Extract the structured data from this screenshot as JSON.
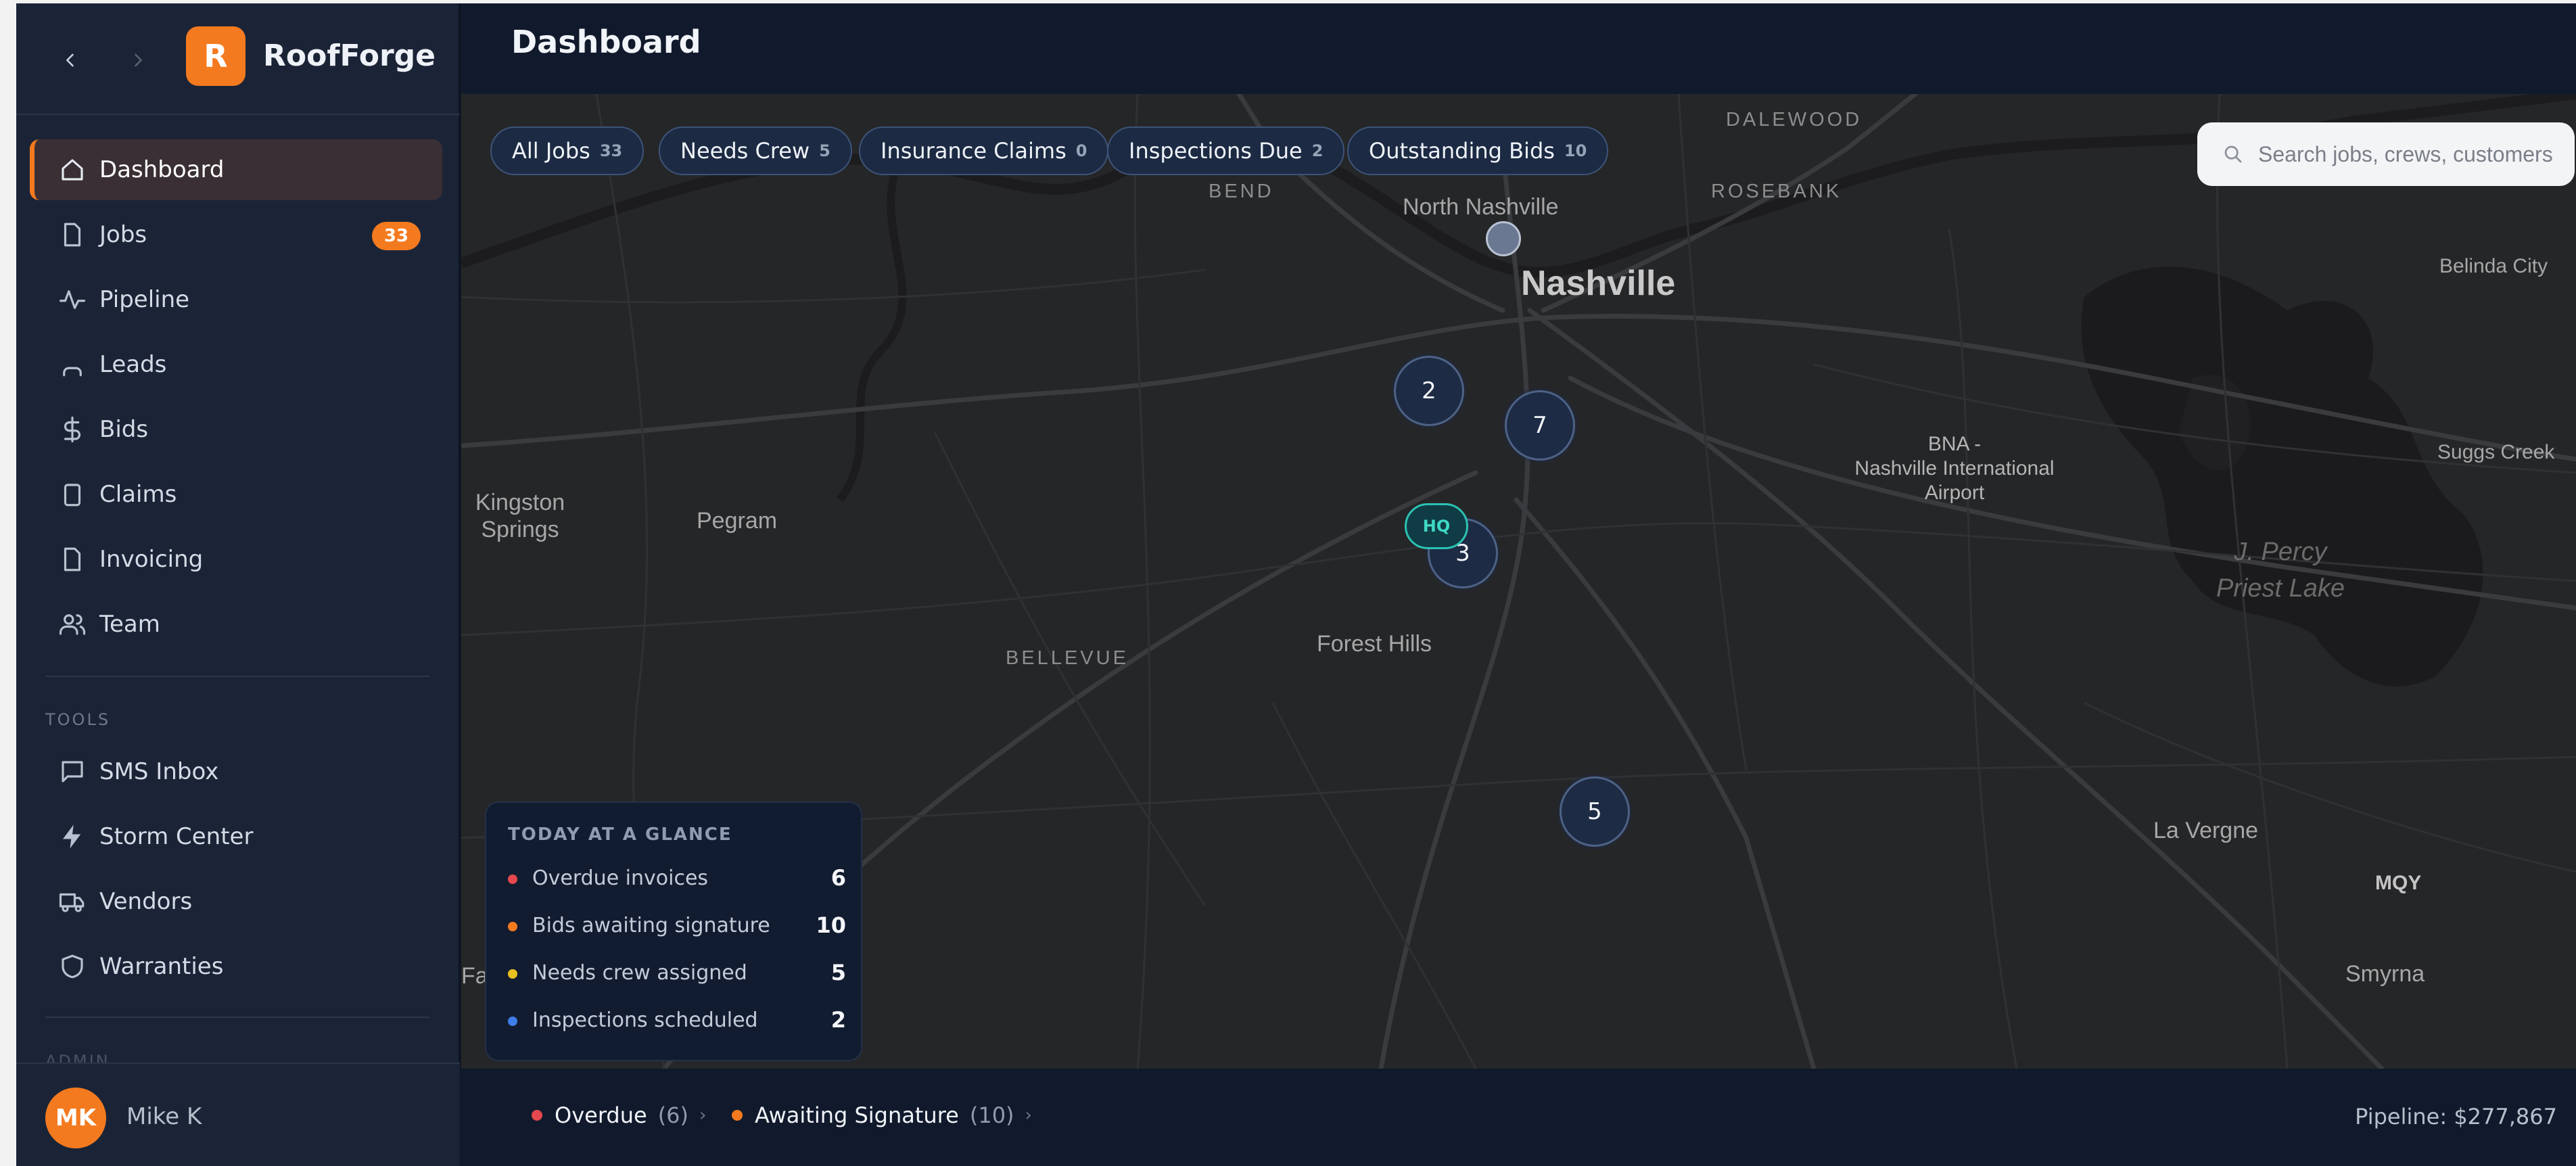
{
  "brand": {
    "logo_letter": "R",
    "name": "RoofForge"
  },
  "sidebar": {
    "items": [
      {
        "label": "Dashboard",
        "icon": "home-icon",
        "active": true
      },
      {
        "label": "Jobs",
        "icon": "file-icon",
        "badge": "33"
      },
      {
        "label": "Pipeline",
        "icon": "activity-icon"
      },
      {
        "label": "Leads",
        "icon": "leads-icon"
      },
      {
        "label": "Bids",
        "icon": "dollar-icon"
      },
      {
        "label": "Claims",
        "icon": "clipboard-icon"
      },
      {
        "label": "Invoicing",
        "icon": "invoice-icon"
      },
      {
        "label": "Team",
        "icon": "users-icon"
      }
    ],
    "tools_label": "TOOLS",
    "tools": [
      {
        "label": "SMS Inbox",
        "icon": "message-icon"
      },
      {
        "label": "Storm Center",
        "icon": "lightning-icon"
      },
      {
        "label": "Vendors",
        "icon": "truck-icon"
      },
      {
        "label": "Warranties",
        "icon": "shield-icon"
      }
    ],
    "admin_label": "ADMIN"
  },
  "user": {
    "initials": "MK",
    "name": "Mike K"
  },
  "header": {
    "title": "Dashboard"
  },
  "filters": [
    {
      "label": "All Jobs",
      "count": "33"
    },
    {
      "label": "Needs Crew",
      "count": "5"
    },
    {
      "label": "Insurance Claims",
      "count": "0"
    },
    {
      "label": "Inspections Due",
      "count": "2"
    },
    {
      "label": "Outstanding Bids",
      "count": "10"
    }
  ],
  "search": {
    "placeholder": "Search jobs, crews, customers"
  },
  "map": {
    "labels": {
      "dalewood": "DALEWOOD",
      "rosebank": "ROSEBANK",
      "bend": "BEND",
      "north_nashville": "North Nashville",
      "nashville": "Nashville",
      "belinda_city": "Belinda City",
      "bna_1": "BNA -",
      "bna_2": "Nashville International",
      "bna_3": "Airport",
      "suggs_creek": "Suggs Creek",
      "kingston_1": "Kingston",
      "kingston_2": "Springs",
      "pegram": "Pegram",
      "percy_1": "J. Percy",
      "percy_2": "Priest Lake",
      "bellevue": "BELLEVUE",
      "forest_hills": "Forest Hills",
      "la_vergne": "La Vergne",
      "mqy": "MQY",
      "smyrna": "Smyrna",
      "fa": "Fa"
    },
    "clusters": [
      "2",
      "7",
      "3",
      "5"
    ],
    "hq_label": "HQ"
  },
  "glance": {
    "title": "TODAY AT A GLANCE",
    "rows": [
      {
        "label": "Overdue invoices",
        "value": "6",
        "color": "#e5484d"
      },
      {
        "label": "Bids awaiting signature",
        "value": "10",
        "color": "#f47a1f"
      },
      {
        "label": "Needs crew assigned",
        "value": "5",
        "color": "#e8c21d"
      },
      {
        "label": "Inspections scheduled",
        "value": "2",
        "color": "#3f7de8"
      }
    ]
  },
  "bottom": {
    "overdue_label": "Overdue",
    "overdue_count": "(6)",
    "awaiting_label": "Awaiting Signature",
    "awaiting_count": "(10)",
    "chevron": "›",
    "pipeline": "Pipeline: $277,867"
  },
  "colors": {
    "accent": "#f47a1f",
    "overdue": "#e5484d",
    "hq": "#2bc3b3"
  }
}
